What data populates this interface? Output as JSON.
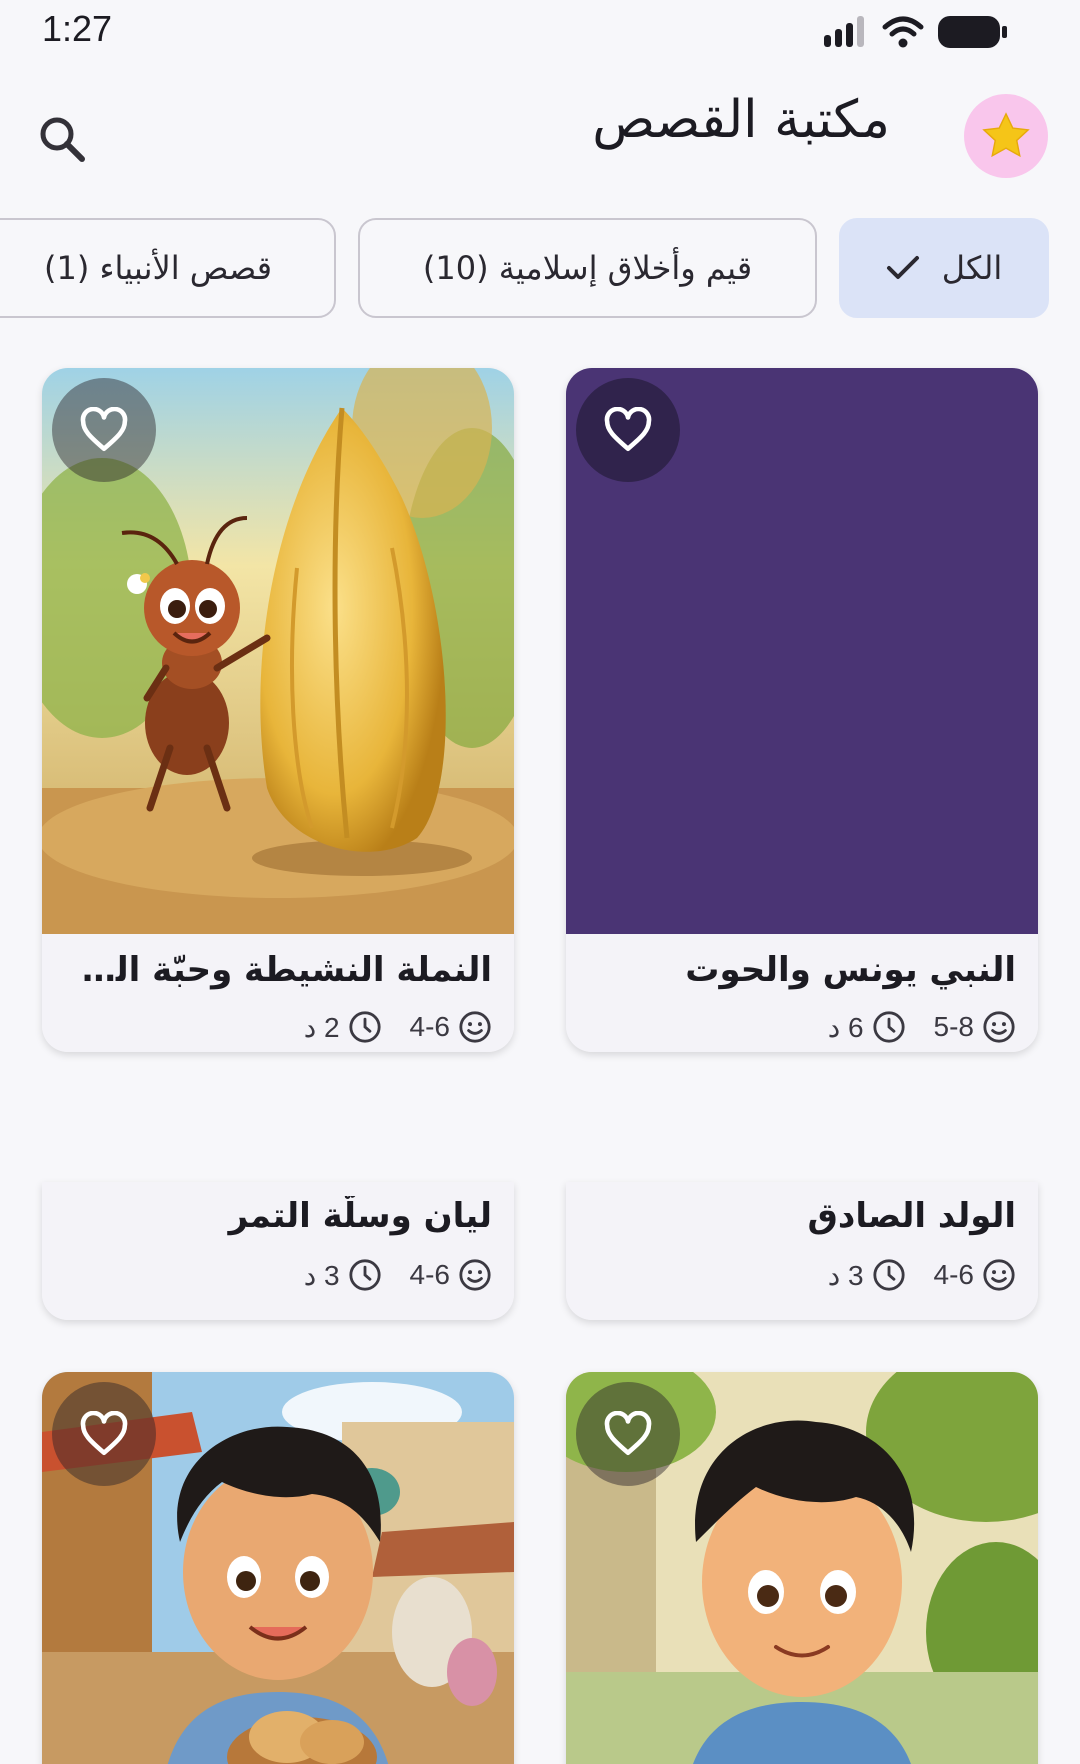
{
  "status_bar": {
    "time": "1:27"
  },
  "app_bar": {
    "title": "مكتبة القصص"
  },
  "filters": {
    "all_label": "الكل",
    "values_label": "قيم وأخلاق إسلامية (10)",
    "prophets_label": "قصص الأنبياء (1)"
  },
  "stories": [
    {
      "title": "النبي يونس والحوت",
      "age": "5-8",
      "duration": "6 د"
    },
    {
      "title": "النملة النشيطة وحبّة القمح",
      "age": "4-6",
      "duration": "2 د"
    },
    {
      "title": "الولد الصادق",
      "age": "4-6",
      "duration": "3 د"
    },
    {
      "title": "ليان وسلّة التمر",
      "age": "4-6",
      "duration": "3 د"
    }
  ],
  "colors": {
    "accent_chip": "#dbe3f7",
    "star_button": "#f9c6ec",
    "star": "#f5c518",
    "placeholder_purple": "#4a3474"
  }
}
